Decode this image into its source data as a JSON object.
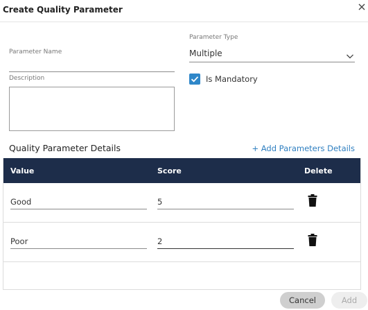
{
  "dialog": {
    "title": "Create Quality Parameter"
  },
  "form": {
    "parameter_name": {
      "label": "Parameter Name",
      "value": ""
    },
    "parameter_type": {
      "label": "Parameter Type",
      "value": "Multiple"
    },
    "description": {
      "label": "Description",
      "value": ""
    },
    "is_mandatory": {
      "label": "Is Mandatory",
      "checked": true
    }
  },
  "details": {
    "title": "Quality Parameter Details",
    "add_link": "+ Add Parameters Details",
    "columns": [
      "Value",
      "Score",
      "Delete"
    ],
    "rows": [
      {
        "value": "Good",
        "score": "5"
      },
      {
        "value": "Poor",
        "score": "2"
      }
    ]
  },
  "footer": {
    "cancel_label": "Cancel",
    "add_label": "Add"
  },
  "colors": {
    "header_bg": "#1d2d4a",
    "accent": "#2f87c9",
    "link": "#2f7fc0"
  }
}
